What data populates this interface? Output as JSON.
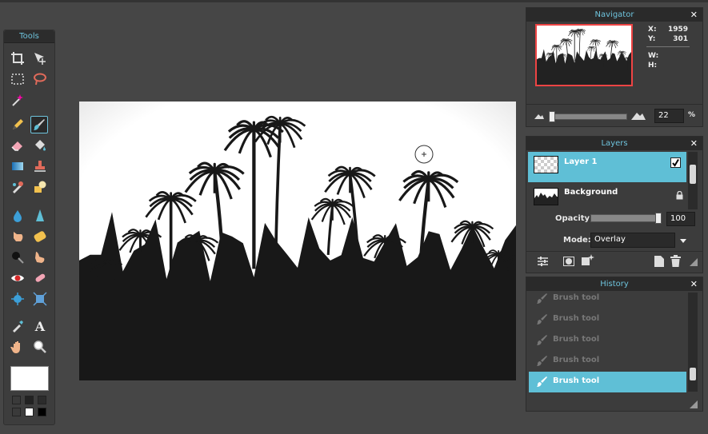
{
  "tools_panel": {
    "title": "Tools"
  },
  "navigator": {
    "title": "Navigator",
    "x_label": "X:",
    "x_value": "1959",
    "y_label": "Y:",
    "y_value": "301",
    "w_label": "W:",
    "h_label": "H:",
    "zoom_value": "22",
    "zoom_unit": "%"
  },
  "layers": {
    "title": "Layers",
    "items": [
      {
        "name": "Layer 1",
        "visible": true,
        "selected": true
      },
      {
        "name": "Background",
        "locked": true,
        "selected": false
      }
    ],
    "opacity_label": "Opacity:",
    "opacity_value": "100",
    "mode_label": "Mode:",
    "mode_value": "Overlay"
  },
  "history": {
    "title": "History",
    "items": [
      "Brush tool",
      "Brush tool",
      "Brush tool",
      "Brush tool",
      "Brush tool"
    ],
    "selected_index": 4
  },
  "close_glyph": "✕",
  "colors": {
    "accent": "#5fbfd6",
    "panel_title": "#6ec3dc",
    "primary_color": "#ffffff"
  }
}
